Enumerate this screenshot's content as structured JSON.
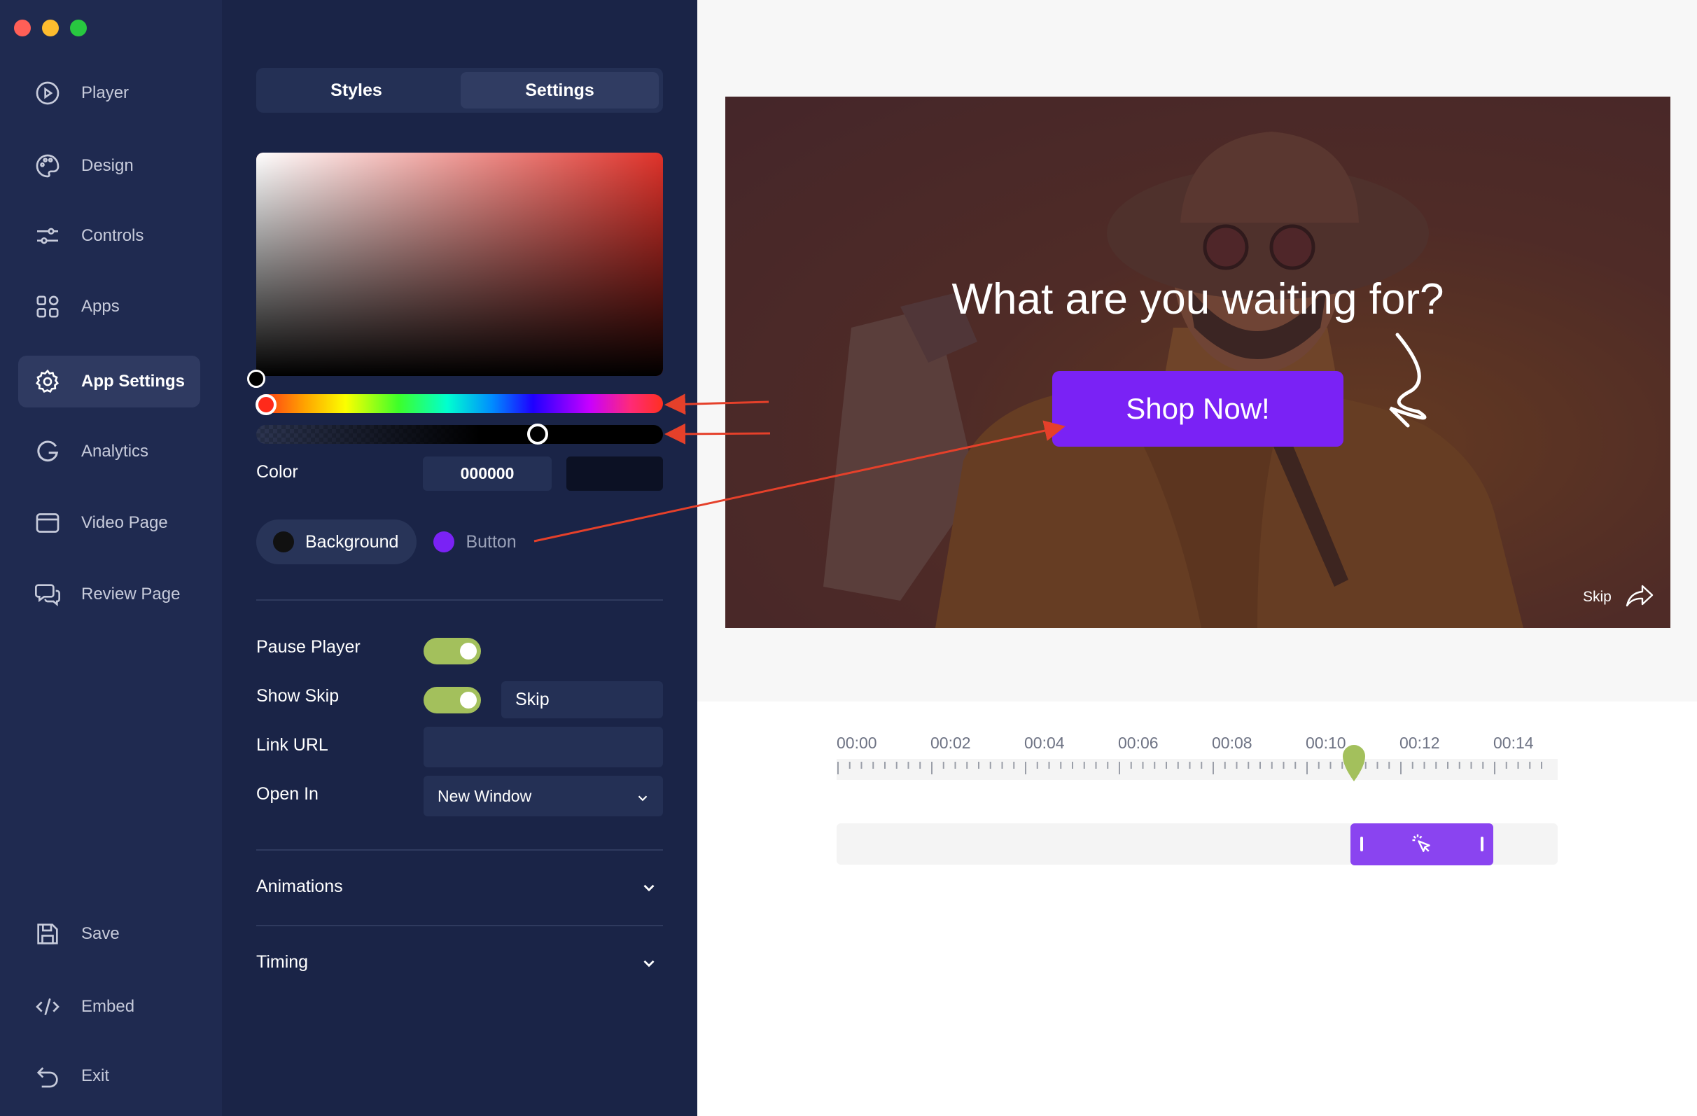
{
  "window": {
    "controls": [
      {
        "name": "close",
        "color": "#ff5f57"
      },
      {
        "name": "minimize",
        "color": "#febc2e"
      },
      {
        "name": "zoom",
        "color": "#28c840"
      }
    ]
  },
  "sidebar": {
    "items": [
      {
        "label": "Player",
        "icon": "play-circle-icon"
      },
      {
        "label": "Design",
        "icon": "palette-icon"
      },
      {
        "label": "Controls",
        "icon": "sliders-icon"
      },
      {
        "label": "Apps",
        "icon": "apps-grid-icon"
      },
      {
        "label": "App Settings",
        "icon": "gear-icon",
        "active": true
      },
      {
        "label": "Analytics",
        "icon": "analytics-g-icon"
      },
      {
        "label": "Video Page",
        "icon": "browser-window-icon"
      },
      {
        "label": "Review Page",
        "icon": "chat-bubbles-icon"
      }
    ],
    "bottom": [
      {
        "label": "Save",
        "icon": "floppy-disk-icon"
      },
      {
        "label": "Embed",
        "icon": "code-brackets-icon"
      },
      {
        "label": "Exit",
        "icon": "undo-arrow-icon"
      }
    ]
  },
  "panel": {
    "tabs": {
      "styles": "Styles",
      "settings": "Settings",
      "active": "Settings"
    },
    "picker": {
      "hue_color": "#e0322a",
      "hue_position": 0.0,
      "alpha_position": 0.69
    },
    "color": {
      "label": "Color",
      "hex": "000000",
      "swatch": "#0c1124"
    },
    "targets": {
      "background": {
        "label": "Background",
        "color": "#111111",
        "selected": true
      },
      "button": {
        "label": "Button",
        "color": "#7a22f5",
        "selected": false
      }
    },
    "pause_player": {
      "label": "Pause Player",
      "on": true
    },
    "show_skip": {
      "label": "Show Skip",
      "on": true,
      "text": "Skip"
    },
    "link_url": {
      "label": "Link URL",
      "value": ""
    },
    "open_in": {
      "label": "Open In",
      "value": "New Window"
    },
    "sections": {
      "animations": "Animations",
      "timing": "Timing"
    },
    "toggle_color": "#a3c05c"
  },
  "preview": {
    "headline": "What are you waiting for?",
    "cta": "Shop Now!",
    "cta_color": "#7a22f5",
    "skip": "Skip"
  },
  "timeline": {
    "ticks": [
      "00:00",
      "00:02",
      "00:04",
      "00:06",
      "00:08",
      "00:10",
      "00:12",
      "00:14"
    ],
    "playhead_time": "00:11",
    "clip": {
      "start_seconds": 10.9,
      "end_seconds": 13.9,
      "icon": "click-cursor-icon",
      "color": "#8a44f0"
    }
  }
}
